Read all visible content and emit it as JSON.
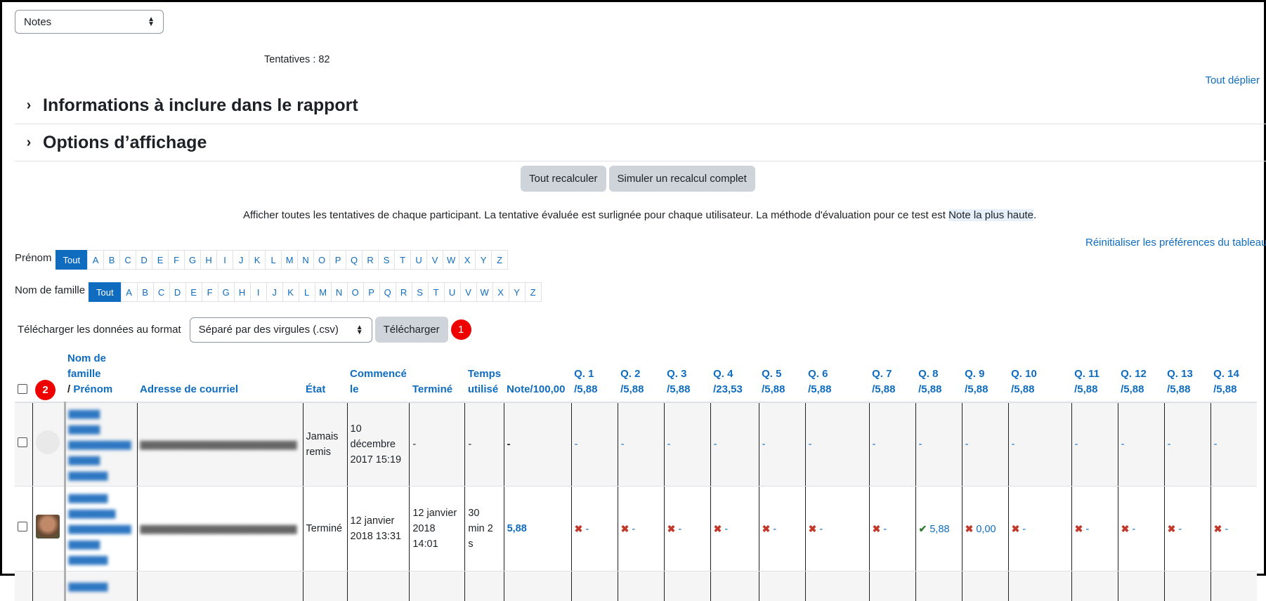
{
  "view_select": {
    "value": "Notes"
  },
  "attempts_text": "Tentatives : 82",
  "expand_all": "Tout déplier",
  "sections": {
    "report_info": "Informations à inclure dans le rapport",
    "display_options": "Options d’affichage"
  },
  "buttons": {
    "recalc_all": "Tout recalculer",
    "simulate_recalc": "Simuler un recalcul complet"
  },
  "info_line": {
    "text": "Afficher toutes les tentatives de chaque participant. La tentative évaluée est surlignée pour chaque utilisateur. La méthode d'évaluation pour ce test est ",
    "highlight": "Note la plus haute",
    "end": "."
  },
  "reset_prefs": "Réinitialiser les préférences du tableau",
  "firstname_filter": {
    "label": "Prénom",
    "letters": [
      "Tout",
      "A",
      "B",
      "C",
      "D",
      "E",
      "F",
      "G",
      "H",
      "I",
      "J",
      "K",
      "L",
      "M",
      "N",
      "O",
      "P",
      "Q",
      "R",
      "S",
      "T",
      "U",
      "V",
      "W",
      "X",
      "Y",
      "Z"
    ]
  },
  "lastname_filter": {
    "label": "Nom de famille",
    "letters": [
      "Tout",
      "A",
      "B",
      "C",
      "D",
      "E",
      "F",
      "G",
      "H",
      "I",
      "J",
      "K",
      "L",
      "M",
      "N",
      "O",
      "P",
      "Q",
      "R",
      "S",
      "T",
      "U",
      "V",
      "W",
      "X",
      "Y",
      "Z"
    ]
  },
  "download": {
    "label": "Télécharger les données au format",
    "format": "Séparé par des virgules (.csv)",
    "button": "Télécharger",
    "badge": "1"
  },
  "table": {
    "badge": "2",
    "headers": {
      "lastname_line1": "Nom de",
      "lastname_line2": "famille",
      "firstname_sep": "/ ",
      "firstname": "Prénom",
      "email": "Adresse de courriel",
      "state": "État",
      "started_1": "Commencé",
      "started_2": "le",
      "finished": "Terminé",
      "time_1": "Temps",
      "time_2": "utilisé",
      "grade": "Note/100,00",
      "questions": [
        {
          "q": "Q. 1",
          "max": "/5,88"
        },
        {
          "q": "Q. 2",
          "max": "/5,88"
        },
        {
          "q": "Q. 3",
          "max": "/5,88"
        },
        {
          "q": "Q. 4",
          "max": "/23,53"
        },
        {
          "q": "Q. 5",
          "max": "/5,88"
        },
        {
          "q": "Q. 6",
          "max": "/5,88"
        },
        {
          "q": "Q. 7",
          "max": "/5,88"
        },
        {
          "q": "Q. 8",
          "max": "/5,88"
        },
        {
          "q": "Q. 9",
          "max": "/5,88"
        },
        {
          "q": "Q. 10",
          "max": "/5,88"
        },
        {
          "q": "Q. 11",
          "max": "/5,88"
        },
        {
          "q": "Q. 12",
          "max": "/5,88"
        },
        {
          "q": "Q. 13",
          "max": "/5,88"
        },
        {
          "q": "Q. 14",
          "max": "/5,88"
        }
      ]
    },
    "rows": [
      {
        "state_1": "Jamais",
        "state_2": "remis",
        "started_1": "10",
        "started_2": "décembre",
        "started_3": "2017 15:19",
        "finished": "-",
        "time": "-",
        "grade": "-",
        "q": [
          "-",
          "-",
          "-",
          "-",
          "-",
          "-",
          "-",
          "-",
          "-",
          "-",
          "-",
          "-",
          "-",
          "-"
        ]
      },
      {
        "state": "Terminé",
        "started_1": "12 janvier",
        "started_2": "2018 13:31",
        "finished_1": "12 janvier",
        "finished_2": "2018",
        "finished_3": "14:01",
        "time_1": "30",
        "time_2": "min 2",
        "time_3": "s",
        "grade": "5,88",
        "q": [
          "-",
          "-",
          "-",
          "-",
          "-",
          "-",
          "-",
          "5,88",
          "0,00",
          "-",
          "-",
          "-",
          "-",
          "-"
        ]
      }
    ]
  },
  "colors": {
    "link": "#0f6cbf",
    "badge": "#ee0000",
    "button": "#ced4da"
  }
}
